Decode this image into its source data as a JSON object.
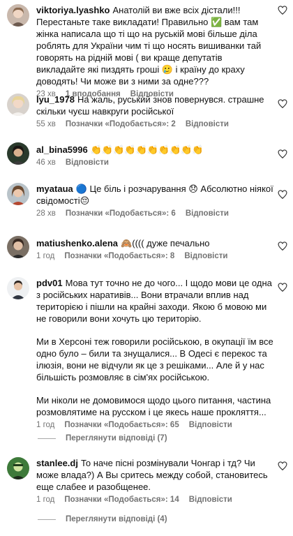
{
  "comments": [
    {
      "username": "viktoriya.lyashko",
      "text": "Анатолій ви вже всіх дістали!!! Перестаньте таке викладати! Правильно ✅ вам там жінка написала що ті що на руській мові більше діла роблять для України чим ті що носять вишиванки тай говорять на рідній мові ( ви краще депутатів викладайте які пиздять гроші 🥲 і країну до краху доводять! Чи може ви з ними за одне???",
      "time": "23 хв",
      "likes": "1 вподобання",
      "reply": "Відповісти"
    },
    {
      "username": "lyu_1978",
      "text": "На жаль, руський знов повернувся. страшне скільки чуєш навкруги російської",
      "time": "55 хв",
      "likes": "Позначки «Подобається»: 2",
      "reply": "Відповісти"
    },
    {
      "username": "al_bina5996",
      "text": "👏👏👏👏👏👏👏👏👏👏",
      "time": "46 хв",
      "likes": "",
      "reply": "Відповісти"
    },
    {
      "username": "myataua",
      "text": "🔵 Це біль і розчарування 😞 Абсолютно ніякої свідомості😔",
      "time": "28 хв",
      "likes": "Позначки «Подобається»: 6",
      "reply": "Відповісти"
    },
    {
      "username": "matiushenko.alena",
      "text": "🙈(((( дуже печально",
      "time": "1 год",
      "likes": "Позначки «Подобається»: 8",
      "reply": "Відповісти"
    },
    {
      "username": "pdv01",
      "paragraphs": [
        "Мова тут точно не до чого... І щодо мови це одна з російських наративів... Вони втрачали вплив над територією і пішли на крайні заходи. Якою б мовою ми не говорили вони хочуть цю територію.",
        "Ми в Херсоні теж говорили російською, в окупації їм все одно було – били та знущалися... В Одесі є перекос та ілюзія, вони не відчули як це з решіками... Але й у нас більшість розмовляє в сім'ях російською.",
        "Ми ніколи не домовимося щодо цього питання, частина розмовлятиме на русском і це якесь наше прокляття..."
      ],
      "time": "1 год",
      "likes": "Позначки «Подобається»: 65",
      "reply": "Відповісти",
      "view_replies": "Переглянути відповіді (7)"
    },
    {
      "username": "stanlee.dj",
      "text": "То наче пісні розмінували Чонгар і тд? Чи може влада?) А Вы сритесь между собой, становитесь еще слабее и разобщенее.",
      "time": "1 год",
      "likes": "Позначки «Подобається»: 14",
      "reply": "Відповісти",
      "view_replies": "Переглянути відповіді (4)"
    }
  ],
  "icons": {
    "like": "heart-outline-icon"
  }
}
